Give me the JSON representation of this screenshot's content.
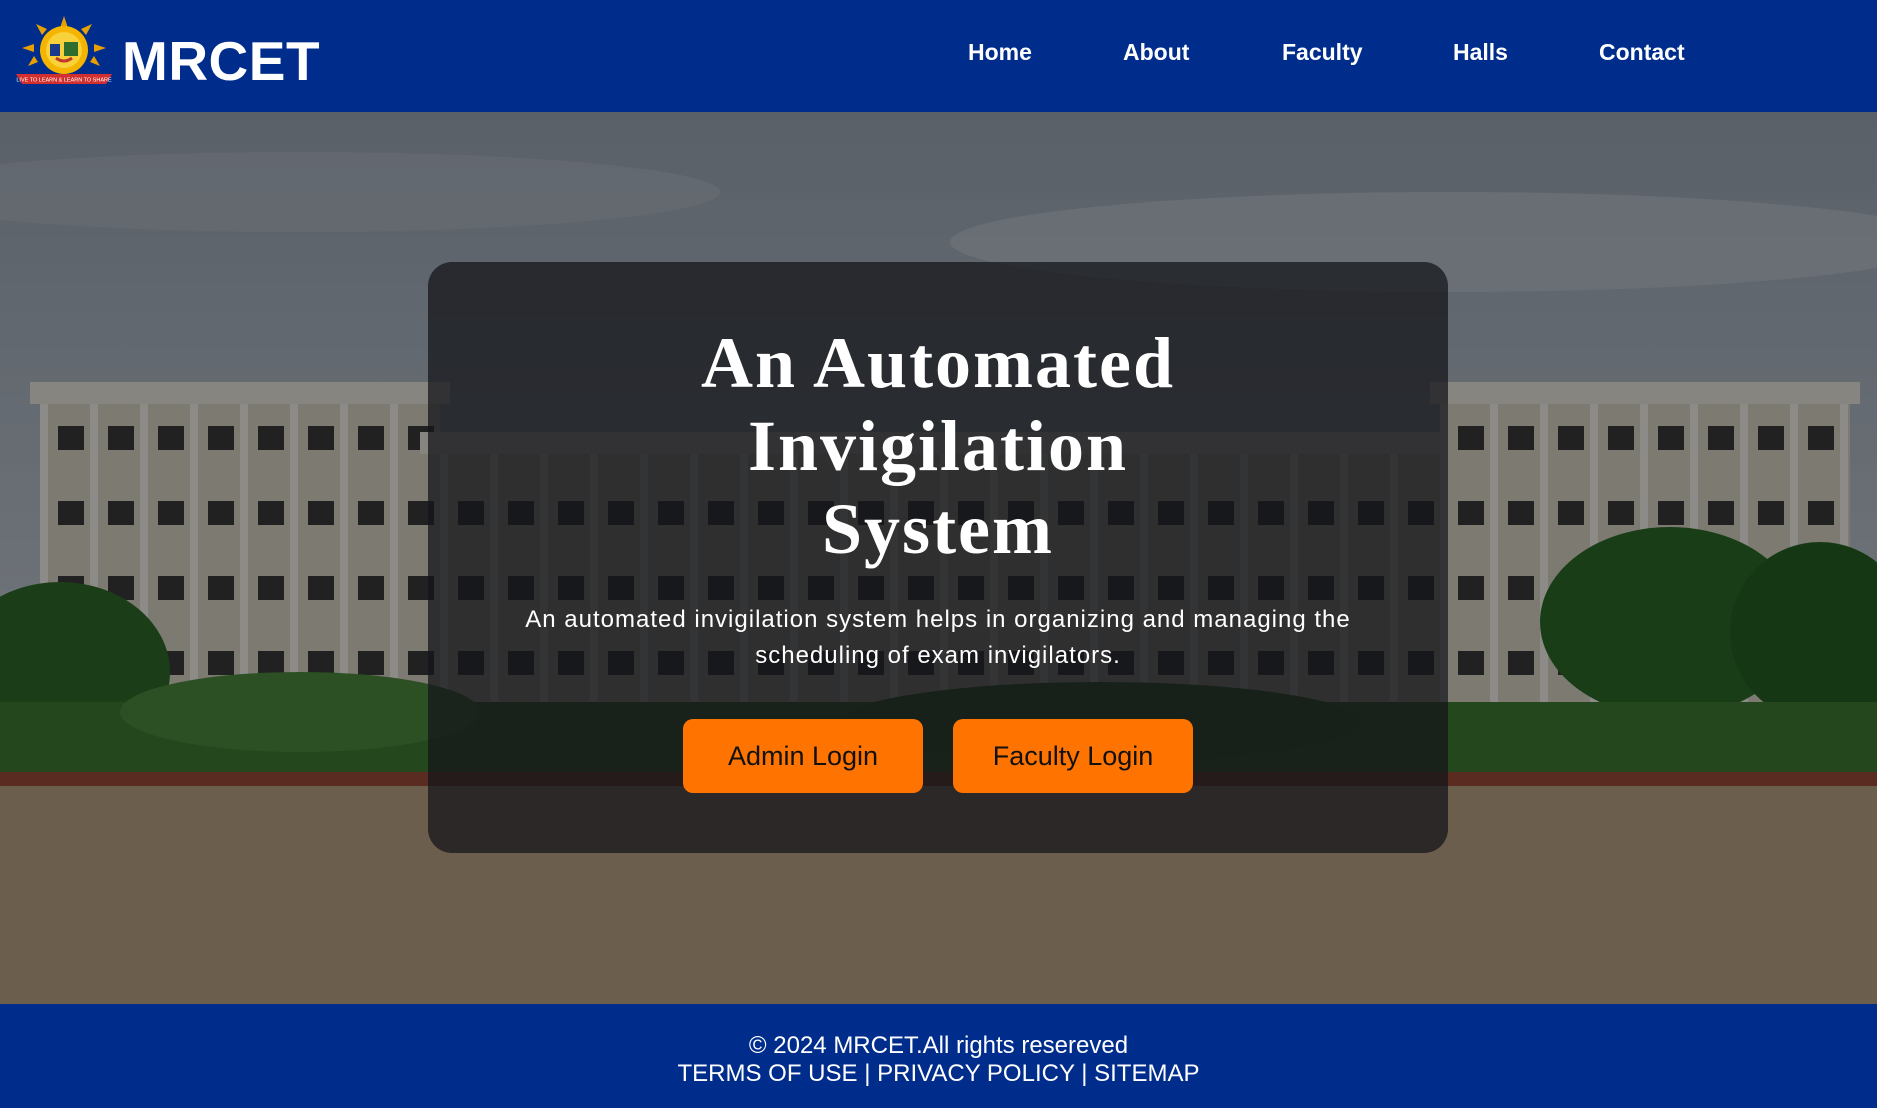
{
  "header": {
    "brand": "MRCET",
    "logo_motto": "LIVE TO LEARN & LEARN TO SHARE",
    "nav": [
      "Home",
      "About",
      "Faculty",
      "Halls",
      "Contact"
    ]
  },
  "hero": {
    "title_lines": [
      "An Automated",
      "Invigilation",
      "System"
    ],
    "description": "An automated invigilation system helps in organizing and managing the scheduling of exam invigilators.",
    "admin_login": "Admin Login",
    "faculty_login": "Faculty Login"
  },
  "footer": {
    "copyright": "© 2024 MRCET.All rights resereved",
    "terms": "TERMS OF USE",
    "privacy": "PRIVACY POLICY",
    "sitemap": "SITEMAP",
    "separator": " | "
  },
  "colors": {
    "header_bg": "#002d8c",
    "button_bg": "#ff7300",
    "card_bg": "rgba(20,22,26,0.74)"
  }
}
